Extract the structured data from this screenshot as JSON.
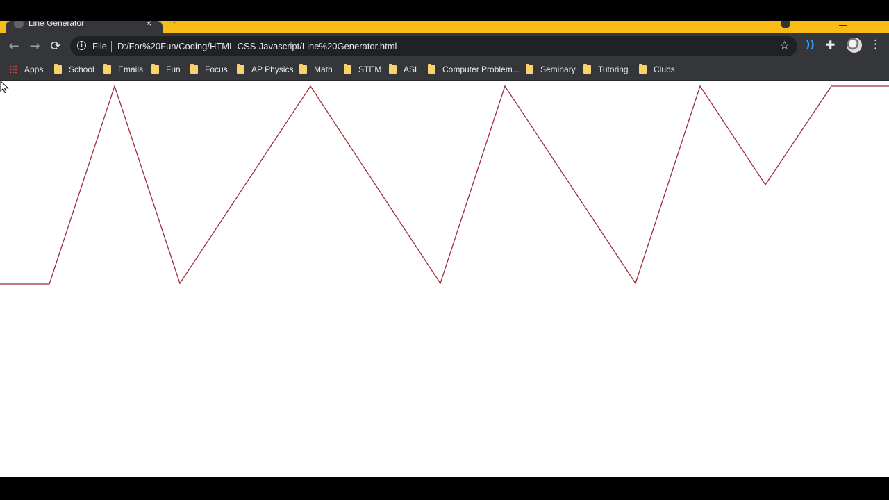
{
  "tab": {
    "title": "Line Generator",
    "close_label": "×",
    "new_tab_label": "+"
  },
  "toolbar": {
    "back_label": "←",
    "forward_label": "→",
    "reload_label": "⟳",
    "info_label": "i",
    "scheme_label": "File",
    "url": "D:/For%20Fun/Coding/HTML-CSS-Javascript/Line%20Generator.html",
    "star_label": "☆",
    "puzzle_label": "✚",
    "wave_label": "))",
    "menu_label": "⋮"
  },
  "bookmarks": [
    {
      "label": "Apps",
      "icon": "apps-grid-icon"
    },
    {
      "label": "School",
      "icon": "folder-icon"
    },
    {
      "label": "Emails",
      "icon": "folder-icon"
    },
    {
      "label": "Fun",
      "icon": "folder-icon"
    },
    {
      "label": "Focus",
      "icon": "folder-icon"
    },
    {
      "label": "AP Physics",
      "icon": "folder-icon"
    },
    {
      "label": "Math",
      "icon": "folder-icon"
    },
    {
      "label": "STEM",
      "icon": "folder-icon"
    },
    {
      "label": "ASL",
      "icon": "folder-icon"
    },
    {
      "label": "Computer Problem...",
      "icon": "folder-icon"
    },
    {
      "label": "Seminary",
      "icon": "folder-icon"
    },
    {
      "label": "Tutoring",
      "icon": "folder-icon"
    },
    {
      "label": "Clubs",
      "icon": "folder-icon"
    }
  ],
  "colors": {
    "tab_strip": "#f9bb16",
    "toolbar": "#35363a",
    "line": "#9e2b3a",
    "page": "#ffffff"
  }
}
